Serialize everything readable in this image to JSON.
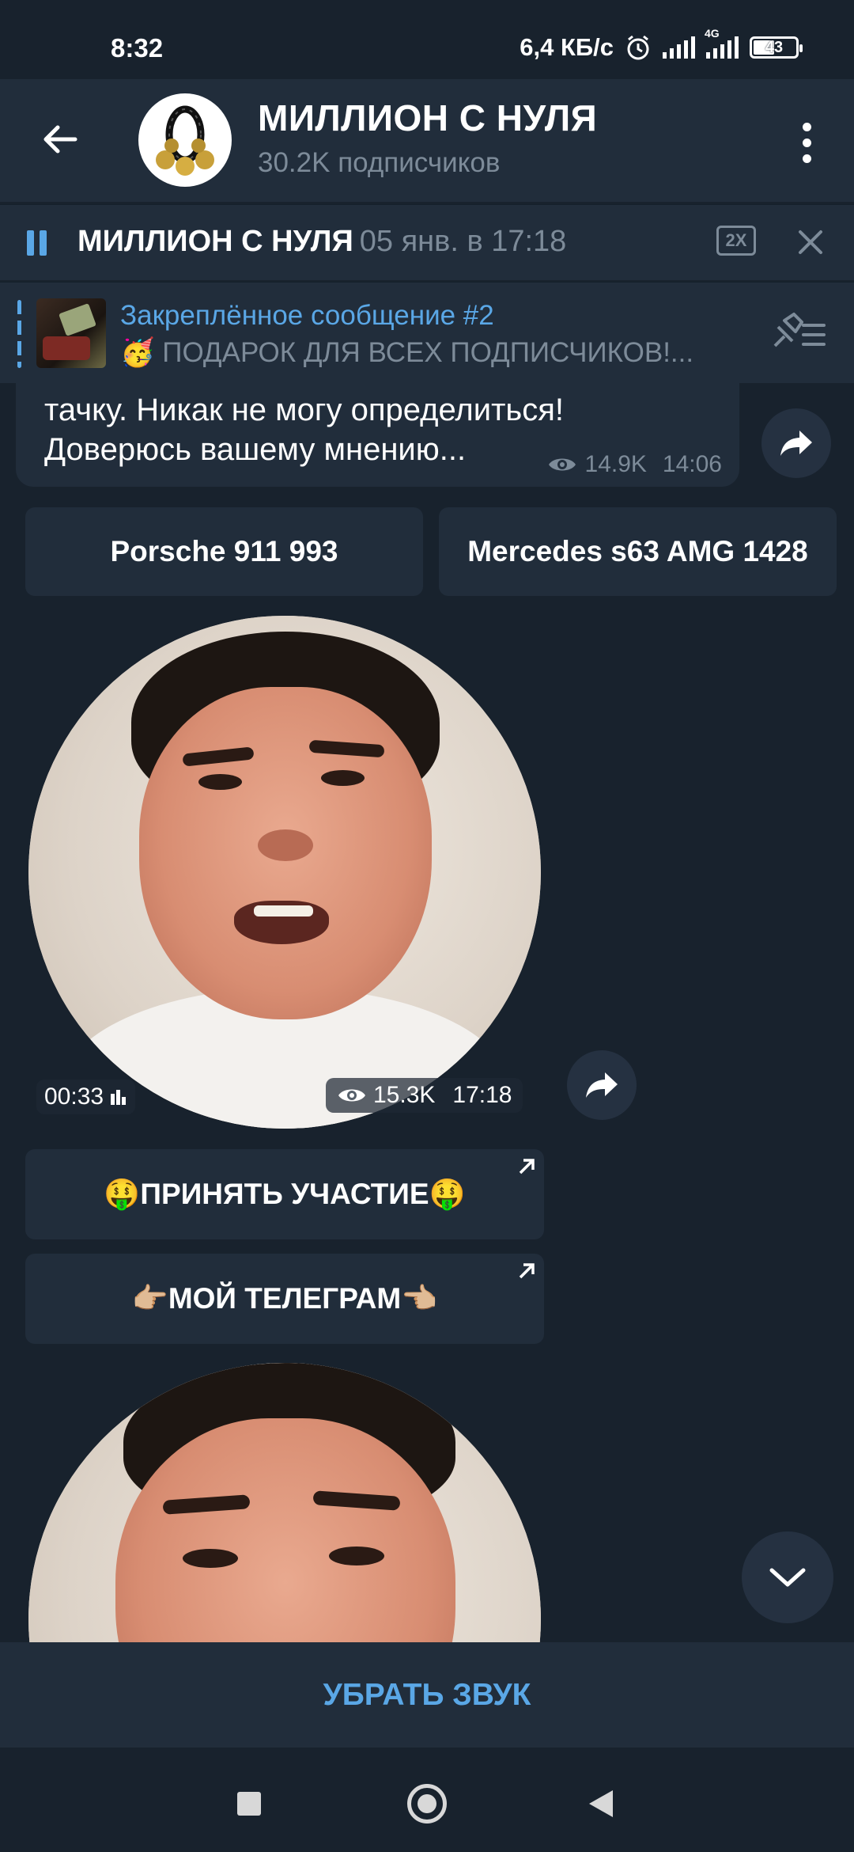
{
  "status_bar": {
    "time": "8:32",
    "network_speed": "6,4 КБ/с",
    "network_type": "4G",
    "battery": "43"
  },
  "header": {
    "title": "МИЛЛИОН С НУЛЯ",
    "subtitle": "30.2K подписчиков"
  },
  "player": {
    "title": "МИЛЛИОН С НУЛЯ",
    "date": "05 янв. в 17:18",
    "speed": "2X"
  },
  "pinned": {
    "label": "Закреплённое сообщение #2",
    "text": "🥳 ПОДАРОК ДЛЯ ВСЕХ ПОДПИСЧИКОВ!..."
  },
  "message": {
    "line1": "тачку. Никак не могу определиться!",
    "line2": "Доверюсь вашему мнению...",
    "views": "14.9K",
    "time": "14:06"
  },
  "vote_buttons": [
    "Porsche 911 993",
    "Mercedes s63 AMG 1428"
  ],
  "video_message": {
    "duration": "00:33",
    "views": "15.3K",
    "time": "17:18"
  },
  "link_buttons": [
    "🤑ПРИНЯТЬ УЧАСТИЕ🤑",
    "👉🏼МОЙ ТЕЛЕГРАМ👈🏼"
  ],
  "bottom_action": "УБРАТЬ ЗВУК",
  "colors": {
    "background": "#18222d",
    "panel": "#212d3b",
    "accent": "#5aa7e6",
    "muted": "#7d8b99"
  }
}
